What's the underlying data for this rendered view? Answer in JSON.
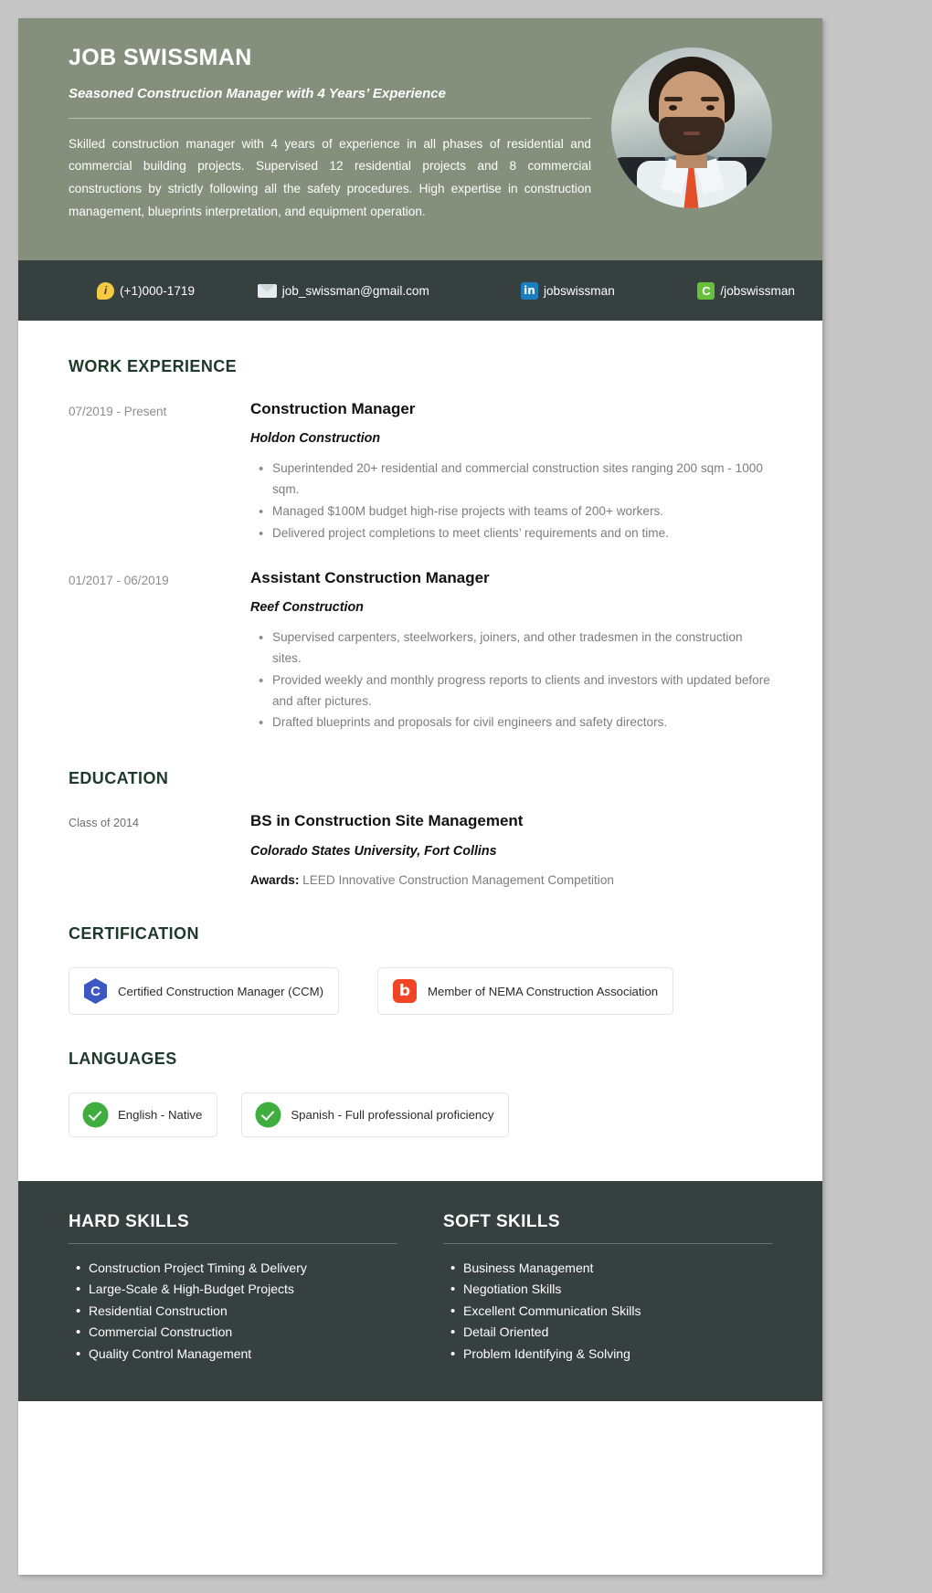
{
  "header": {
    "name": "JOB SWISSMAN",
    "headline": "Seasoned Construction Manager with 4 Years’ Experience",
    "summary": "Skilled construction manager with 4 years of experience in all phases of residential and commercial building projects. Supervised 12 residential projects and 8 commercial constructions by strictly following all the safety procedures. High expertise in construction management, blueprints interpretation, and equipment operation.",
    "photo_alt": "profile-photo"
  },
  "contact": {
    "phone": {
      "icon": "phone-icon",
      "value": "(+1)000-1719"
    },
    "email": {
      "icon": "email-icon",
      "value": "job_swissman@gmail.com"
    },
    "linkedin": {
      "icon": "linkedin-icon",
      "glyph": "in",
      "value": "jobswissman"
    },
    "other": {
      "icon": "green-c-icon",
      "glyph": "C",
      "value": "/jobswissman"
    }
  },
  "sections": {
    "work": {
      "title": "WORK EXPERIENCE",
      "entries": [
        {
          "date": "07/2019 - Present",
          "title": "Construction Manager",
          "company": "Holdon Construction",
          "bullets": [
            "Superintended 20+ residential and commercial construction sites ranging 200 sqm - 1000 sqm.",
            "Managed $100M budget high-rise projects with teams of 200+ workers.",
            "Delivered project completions to meet clients’ requirements and on time."
          ]
        },
        {
          "date": "01/2017 - 06/2019",
          "title": "Assistant Construction Manager",
          "company": "Reef Construction",
          "bullets": [
            "Supervised carpenters, steelworkers, joiners, and other tradesmen in the construction sites.",
            "Provided weekly and monthly progress reports to clients and investors with updated before and after pictures.",
            "Drafted blueprints and proposals for civil engineers and safety directors."
          ]
        }
      ]
    },
    "education": {
      "title": "EDUCATION",
      "entries": [
        {
          "date": "Class of 2014",
          "degree": "BS in Construction Site Management",
          "school": "Colorado States University, Fort Collins",
          "awards_label": "Awards:",
          "awards_value": "LEED Innovative Construction Management Competition"
        }
      ]
    },
    "certification": {
      "title": "CERTIFICATION",
      "items": [
        {
          "icon": "hex-c-icon",
          "label": "Certified Construction Manager (CCM)"
        },
        {
          "icon": "b-square-icon",
          "label": "Member of NEMA Construction Association"
        }
      ]
    },
    "languages": {
      "title": "LANGUAGES",
      "items": [
        {
          "icon": "check-badge-icon",
          "label": "English - Native"
        },
        {
          "icon": "check-badge-icon",
          "label": "Spanish - Full professional proficiency"
        }
      ]
    },
    "hard_skills": {
      "title": "HARD SKILLS",
      "items": [
        "Construction Project Timing & Delivery",
        "Large-Scale & High-Budget Projects",
        "Residential Construction",
        "Commercial Construction",
        "Quality Control Management"
      ]
    },
    "soft_skills": {
      "title": "SOFT SKILLS",
      "items": [
        "Business Management",
        "Negotiation Skills",
        "Excellent Communication Skills",
        "Detail Oriented",
        "Problem Identifying & Solving"
      ]
    }
  },
  "colors": {
    "header_bg": "#848f7c",
    "dark_bg": "#35403f",
    "accent_green": "#1d3a2a",
    "page_bg": "#c6c6c6"
  }
}
